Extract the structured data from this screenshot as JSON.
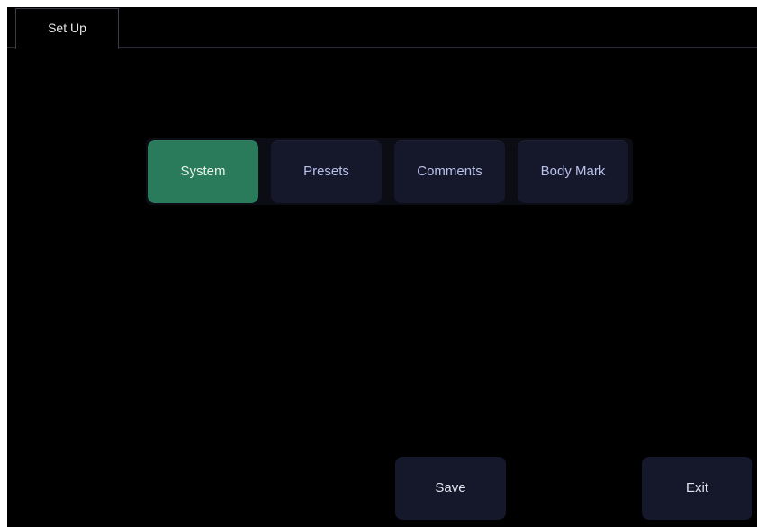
{
  "tabs": [
    {
      "label": "Set Up",
      "active": true
    }
  ],
  "menu": {
    "items": [
      {
        "label": "System",
        "active": true
      },
      {
        "label": "Presets",
        "active": false
      },
      {
        "label": "Comments",
        "active": false
      },
      {
        "label": "Body Mark",
        "active": false
      }
    ]
  },
  "footer": {
    "save_label": "Save",
    "exit_label": "Exit"
  },
  "colors": {
    "background": "#000000",
    "button": "#15172a",
    "active_button": "#2a7a5c",
    "button_text": "#b9c0ea"
  }
}
